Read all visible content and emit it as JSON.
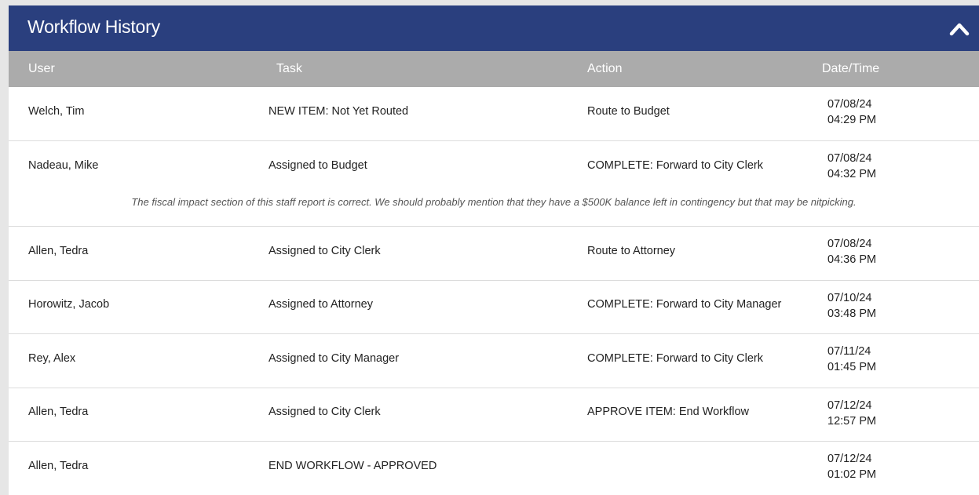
{
  "header": {
    "title": "Workflow History",
    "collapse_icon": "chevron-up-icon"
  },
  "columns": {
    "user": "User",
    "task": "Task",
    "action": "Action",
    "datetime": "Date/Time"
  },
  "colors": {
    "header_bg": "#2a3f7e",
    "column_header_bg": "#ababab"
  },
  "rows": [
    {
      "user": "Welch, Tim",
      "task": "NEW ITEM: Not Yet Routed",
      "action": "Route to Budget",
      "date": "07/08/24",
      "time": "04:29 PM"
    },
    {
      "user": "Nadeau, Mike",
      "task": "Assigned to Budget",
      "action": "COMPLETE: Forward to City Clerk",
      "date": "07/08/24",
      "time": "04:32 PM",
      "comment": "The fiscal impact section of this staff report is correct. We should probably mention that they have a $500K balance left in contingency but that may be nitpicking."
    },
    {
      "user": "Allen, Tedra",
      "task": "Assigned to City Clerk",
      "action": "Route to Attorney",
      "date": "07/08/24",
      "time": "04:36 PM"
    },
    {
      "user": "Horowitz, Jacob",
      "task": "Assigned to Attorney",
      "action": "COMPLETE: Forward to City Manager",
      "date": "07/10/24",
      "time": "03:48 PM"
    },
    {
      "user": "Rey, Alex",
      "task": "Assigned to City Manager",
      "action": "COMPLETE: Forward to City Clerk",
      "date": "07/11/24",
      "time": "01:45 PM"
    },
    {
      "user": "Allen, Tedra",
      "task": "Assigned to City Clerk",
      "action": "APPROVE ITEM: End Workflow",
      "date": "07/12/24",
      "time": "12:57 PM"
    },
    {
      "user": "Allen, Tedra",
      "task": "END WORKFLOW - APPROVED",
      "action": "",
      "date": "07/12/24",
      "time": "01:02 PM"
    }
  ]
}
